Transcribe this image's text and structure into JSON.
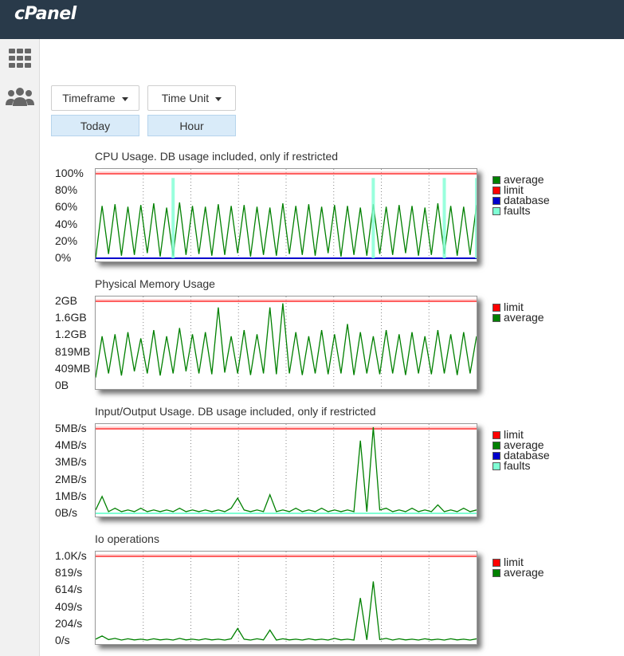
{
  "header": {
    "logo_text": "cPanel"
  },
  "sidebar": {
    "items": [
      {
        "icon": "grid-icon"
      },
      {
        "icon": "users-icon"
      }
    ]
  },
  "controls": {
    "timeframe_label": "Timeframe",
    "timeunit_label": "Time Unit",
    "timeframe_value": "Today",
    "timeunit_value": "Hour"
  },
  "colors": {
    "average": "#008000",
    "limit": "#ff0000",
    "database": "#0000cc",
    "faults": "#7fffd4"
  },
  "chart_data": [
    {
      "type": "line",
      "title": "CPU Usage. DB usage included, only if restricted",
      "yticks": [
        "100%",
        "80%",
        "60%",
        "40%",
        "20%",
        "0%"
      ],
      "ylim": [
        0,
        100
      ],
      "legend": [
        "average",
        "limit",
        "database",
        "faults"
      ],
      "series": [
        {
          "name": "average",
          "values": [
            0,
            62,
            5,
            64,
            3,
            61,
            4,
            63,
            6,
            65,
            2,
            60,
            3,
            66,
            4,
            62,
            5,
            61,
            3,
            64,
            4,
            62,
            6,
            63,
            2,
            61,
            4,
            60,
            3,
            65,
            5,
            62,
            4,
            64,
            3,
            61,
            6,
            63,
            2,
            62,
            4,
            60,
            3,
            64,
            5,
            61,
            4,
            63,
            6,
            62,
            3,
            60,
            4,
            65,
            5,
            62,
            3,
            61,
            4,
            63
          ]
        },
        {
          "name": "limit",
          "values": [
            100
          ]
        },
        {
          "name": "database",
          "values": [
            0
          ]
        },
        {
          "name": "faults",
          "values": [
            0,
            0,
            0,
            0,
            0,
            0,
            0,
            0,
            0,
            0,
            0,
            0,
            95,
            0,
            0,
            0,
            0,
            0,
            0,
            0,
            0,
            0,
            0,
            0,
            0,
            0,
            0,
            0,
            0,
            0,
            0,
            0,
            0,
            0,
            0,
            0,
            0,
            0,
            0,
            0,
            0,
            0,
            0,
            95,
            0,
            0,
            0,
            0,
            0,
            0,
            0,
            0,
            0,
            0,
            95,
            0,
            0,
            0,
            0,
            95
          ]
        }
      ]
    },
    {
      "type": "line",
      "title": "Physical Memory Usage",
      "yticks": [
        "2GB",
        "1.6GB",
        "1.2GB",
        "819MB",
        "409MB",
        "0B"
      ],
      "ylim": [
        0,
        2048
      ],
      "legend": [
        "limit",
        "average"
      ],
      "series": [
        {
          "name": "limit",
          "values": [
            2048
          ]
        },
        {
          "name": "average",
          "values": [
            200,
            1200,
            300,
            1250,
            250,
            1300,
            350,
            1150,
            300,
            1350,
            250,
            1200,
            300,
            1400,
            350,
            1250,
            300,
            1300,
            280,
            1900,
            320,
            1200,
            300,
            1350,
            260,
            1250,
            300,
            1900,
            280,
            2000,
            300,
            1300,
            260,
            1200,
            300,
            1350,
            280,
            1250,
            300,
            1500,
            260,
            1300,
            300,
            1200,
            280,
            1350,
            300,
            1250,
            260,
            1300,
            300,
            1200,
            280,
            1350,
            300,
            1250,
            260,
            1300,
            300,
            1200
          ]
        }
      ]
    },
    {
      "type": "line",
      "title": "Input/Output Usage. DB usage included, only if restricted",
      "yticks": [
        "5MB/s",
        "4MB/s",
        "3MB/s",
        "2MB/s",
        "1MB/s",
        "0B/s"
      ],
      "ylim": [
        0,
        5
      ],
      "legend": [
        "limit",
        "average",
        "database",
        "faults"
      ],
      "series": [
        {
          "name": "limit",
          "values": [
            5
          ]
        },
        {
          "name": "average",
          "values": [
            0.2,
            1.0,
            0.1,
            0.3,
            0.1,
            0.2,
            0.1,
            0.3,
            0.1,
            0.2,
            0.1,
            0.2,
            0.1,
            0.3,
            0.1,
            0.2,
            0.1,
            0.2,
            0.1,
            0.2,
            0.1,
            0.3,
            0.9,
            0.2,
            0.1,
            0.2,
            0.1,
            1.1,
            0.1,
            0.2,
            0.1,
            0.3,
            0.1,
            0.2,
            0.1,
            0.3,
            0.1,
            0.2,
            0.1,
            0.2,
            0.1,
            4.3,
            0.1,
            5.1,
            0.2,
            0.3,
            0.1,
            0.2,
            0.1,
            0.3,
            0.1,
            0.2,
            0.1,
            0.5,
            0.1,
            0.2,
            0.1,
            0.3,
            0.1,
            0.2
          ]
        },
        {
          "name": "database",
          "values": [
            0
          ]
        },
        {
          "name": "faults",
          "values": [
            0
          ]
        }
      ]
    },
    {
      "type": "line",
      "title": "Io operations",
      "yticks": [
        "1.0K/s",
        "819/s",
        "614/s",
        "409/s",
        "204/s",
        "0/s"
      ],
      "ylim": [
        0,
        1024
      ],
      "legend": [
        "limit",
        "average"
      ],
      "series": [
        {
          "name": "limit",
          "values": [
            1024
          ]
        },
        {
          "name": "average",
          "values": [
            20,
            60,
            15,
            30,
            10,
            25,
            12,
            20,
            10,
            25,
            12,
            20,
            10,
            30,
            12,
            20,
            10,
            25,
            12,
            20,
            10,
            25,
            150,
            20,
            10,
            25,
            12,
            130,
            10,
            25,
            12,
            20,
            10,
            25,
            12,
            20,
            10,
            30,
            12,
            20,
            10,
            520,
            12,
            720,
            15,
            30,
            10,
            25,
            12,
            20,
            10,
            25,
            12,
            20,
            10,
            25,
            12,
            20,
            10,
            25
          ]
        }
      ]
    }
  ]
}
